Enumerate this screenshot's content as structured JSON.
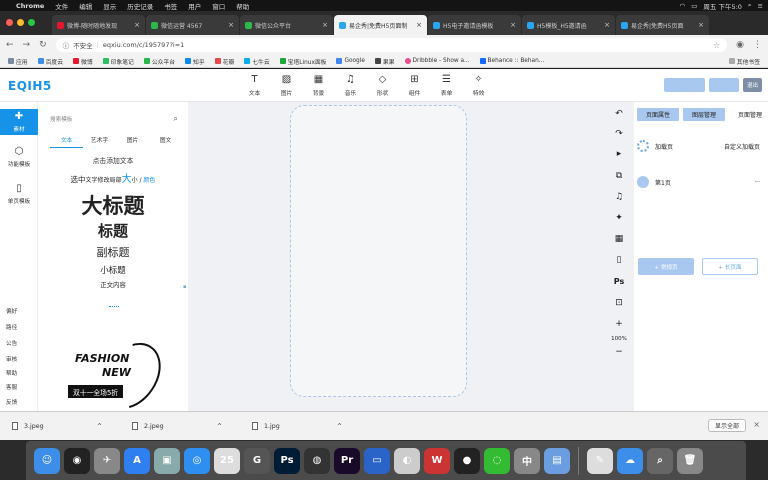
{
  "menubar": {
    "app_name": "Chrome",
    "items": [
      "文件",
      "编辑",
      "显示",
      "历史记录",
      "书签",
      "用户",
      "窗口",
      "帮助"
    ],
    "clock": "周五 下午5:0"
  },
  "tabs": [
    {
      "label": "微博-随时随地发现"
    },
    {
      "label": "微信运营 4567"
    },
    {
      "label": "微信公众平台"
    },
    {
      "label": "易企秀|免费H5页面制"
    },
    {
      "label": "H5电子邀请函模板"
    },
    {
      "label": "H5模板_H5邀请函"
    },
    {
      "label": "易企秀|免费H5页面"
    }
  ],
  "addressbar": {
    "security": "不安全",
    "url": "eqxiu.com/c/195797?i=1"
  },
  "bookmarks": {
    "items": [
      "应用",
      "百度云",
      "微博",
      "印象笔记",
      "公众平台",
      "知乎",
      "花瓣",
      "七牛云",
      "宝塔Linux面板",
      "Google",
      "果果",
      "Dribbble - Show a...",
      "Behance :: Behan..."
    ],
    "other": "其他书签"
  },
  "app": {
    "logo": "EQIH5",
    "tools": [
      {
        "icon": "text-icon",
        "glyph": "T",
        "label": "文本"
      },
      {
        "icon": "image-icon",
        "glyph": "▨",
        "label": "图片"
      },
      {
        "icon": "background-icon",
        "glyph": "▦",
        "label": "背景"
      },
      {
        "icon": "music-icon",
        "glyph": "♫",
        "label": "音乐"
      },
      {
        "icon": "shape-icon",
        "glyph": "◇",
        "label": "形状"
      },
      {
        "icon": "components-icon",
        "glyph": "⊞",
        "label": "组件"
      },
      {
        "icon": "form-icon",
        "glyph": "☰",
        "label": "表单"
      },
      {
        "icon": "effects-icon",
        "glyph": "✧",
        "label": "特效"
      }
    ],
    "actions": [
      "",
      "",
      "退出"
    ],
    "left_nav": {
      "active": "素材",
      "items": [
        "功能模板",
        "单页模板"
      ],
      "bottom": [
        "偏好",
        "路径",
        "公告",
        "审核",
        "帮助",
        "客服",
        "反馈"
      ]
    },
    "panel": {
      "search_placeholder": "搜索模板",
      "subtabs": [
        "文本",
        "艺术字",
        "图片",
        "图文"
      ],
      "add_text": "点击添加文本",
      "mix": {
        "a": "选中",
        "b": "文字修改局部",
        "c": "大",
        "d": "小",
        "e": " / ",
        "f": "颜色"
      },
      "h_big": "大标题",
      "h_title": "标题",
      "h_sub": "副标题",
      "h_small": "小标题",
      "h_body": "正文内容",
      "fashion_1": "FASHION",
      "fashion_2": "NEW",
      "fashion_banner": "双十一全场5折"
    },
    "right_icons": [
      "↶",
      "↷",
      "▸",
      "⧉",
      "♫",
      "✦",
      "▦",
      "▯",
      "Ps",
      "⊡",
      "+",
      "100%",
      "−"
    ],
    "right_panel": {
      "tabs": [
        "页面属性",
        "图层管理",
        "页面管理"
      ],
      "loading_page": "加载页",
      "custom_loading": "自定义加载页",
      "page_1": "第1页",
      "more": "···",
      "btn_regular": "+ 常规页",
      "btn_long": "+ 长页面"
    }
  },
  "downloads": {
    "files": [
      "3.jpeg",
      "2.jpeg",
      "1.jpg"
    ],
    "show_all": "显示全部"
  },
  "dock": {
    "icons": [
      {
        "name": "finder-icon",
        "glyph": "☺",
        "color": "#3c8ee8"
      },
      {
        "name": "siri-icon",
        "glyph": "◉",
        "color": "#222"
      },
      {
        "name": "launchpad-icon",
        "glyph": "✈",
        "color": "#888"
      },
      {
        "name": "appstore-icon",
        "glyph": "A",
        "color": "#2f7ff0"
      },
      {
        "name": "preview-icon",
        "glyph": "▣",
        "color": "#8aa"
      },
      {
        "name": "safari-icon",
        "glyph": "◎",
        "color": "#2f8ff0"
      },
      {
        "name": "calendar-icon",
        "glyph": "25",
        "color": "#ddd"
      },
      {
        "name": "swirl-app-icon",
        "glyph": "G",
        "color": "#555"
      },
      {
        "name": "photoshop-icon",
        "glyph": "Ps",
        "color": "#001c35"
      },
      {
        "name": "quicktime-icon",
        "glyph": "◍",
        "color": "#333"
      },
      {
        "name": "premiere-icon",
        "glyph": "Pr",
        "color": "#1a0a2a"
      },
      {
        "name": "keynote-icon",
        "glyph": "▭",
        "color": "#2a64c8"
      },
      {
        "name": "chrome-icon",
        "glyph": "◐",
        "color": "#ccc"
      },
      {
        "name": "wps-icon",
        "glyph": "W",
        "color": "#c33"
      },
      {
        "name": "qq-icon",
        "glyph": "●",
        "color": "#222"
      },
      {
        "name": "wechat-icon",
        "glyph": "◌",
        "color": "#3b3"
      },
      {
        "name": "ime-icon",
        "glyph": "中",
        "color": "#888"
      },
      {
        "name": "downloads-folder-icon",
        "glyph": "▤",
        "color": "#6a9ee0"
      },
      {
        "name": "screenshot-app-icon",
        "glyph": "✎",
        "color": "#ddd"
      },
      {
        "name": "baidu-netdisk-icon",
        "glyph": "☁",
        "color": "#3c8ee8"
      },
      {
        "name": "quicklook-icon",
        "glyph": "⌕",
        "color": "#666"
      },
      {
        "name": "trash-icon",
        "glyph": "🗑",
        "color": "#888"
      }
    ]
  }
}
